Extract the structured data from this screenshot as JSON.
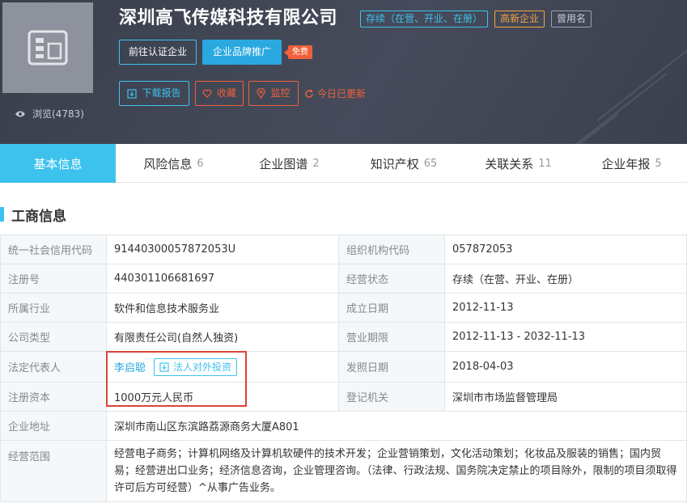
{
  "header": {
    "company_name": "深圳高飞传媒科技有限公司",
    "status_tag": "存续（在营、开业、在册）",
    "hightech_tag": "高新企业",
    "former_name_tag": "曾用名",
    "views": "浏览(4783)",
    "certify_label": "前往认证企业",
    "brand_label": "企业品牌推广",
    "free_badge": "免费",
    "download_label": "下载报告",
    "favorite_label": "收藏",
    "monitor_label": "监控",
    "updated_label": "今日已更新"
  },
  "tabs": [
    {
      "label": "基本信息",
      "count": ""
    },
    {
      "label": "风险信息",
      "count": "6"
    },
    {
      "label": "企业图谱",
      "count": "2"
    },
    {
      "label": "知识产权",
      "count": "65"
    },
    {
      "label": "关联关系",
      "count": "11"
    },
    {
      "label": "企业年报",
      "count": "5"
    }
  ],
  "section": {
    "title": "工商信息"
  },
  "info": {
    "credit_code_label": "统一社会信用代码",
    "credit_code": "91440300057872053U",
    "org_code_label": "组织机构代码",
    "org_code": "057872053",
    "reg_no_label": "注册号",
    "reg_no": "440301106681697",
    "biz_status_label": "经营状态",
    "biz_status": "存续（在营、开业、在册）",
    "industry_label": "所属行业",
    "industry": "软件和信息技术服务业",
    "founded_label": "成立日期",
    "founded": "2012-11-13",
    "company_type_label": "公司类型",
    "company_type": "有限责任公司(自然人独资)",
    "term_label": "营业期限",
    "term": "2012-11-13 - 2032-11-13",
    "legal_rep_label": "法定代表人",
    "legal_rep": "李启聪",
    "invest_label": "法人对外投资",
    "approve_date_label": "发照日期",
    "approve_date": "2018-04-03",
    "capital_label": "注册资本",
    "capital": "1000万元人民币",
    "authority_label": "登记机关",
    "authority": "深圳市市场监督管理局",
    "address_label": "企业地址",
    "address": "深圳市南山区东滨路荔源商务大厦A801",
    "scope_label": "经营范围",
    "scope": "经营电子商务；计算机网络及计算机软硬件的技术开发；企业营销策划，文化活动策划；化妆品及服装的销售；国内贸易；经营进出口业务；经济信息咨询，企业管理咨询。（法律、行政法规、国务院决定禁止的项目除外，限制的项目须取得许可后方可经营）^从事广告业务。"
  },
  "colors": {
    "accent": "#3dc2ee",
    "warning": "#f1603b",
    "hightech": "#f5a342",
    "highlight_box": "#d9453a",
    "header_bg": "#414654"
  }
}
